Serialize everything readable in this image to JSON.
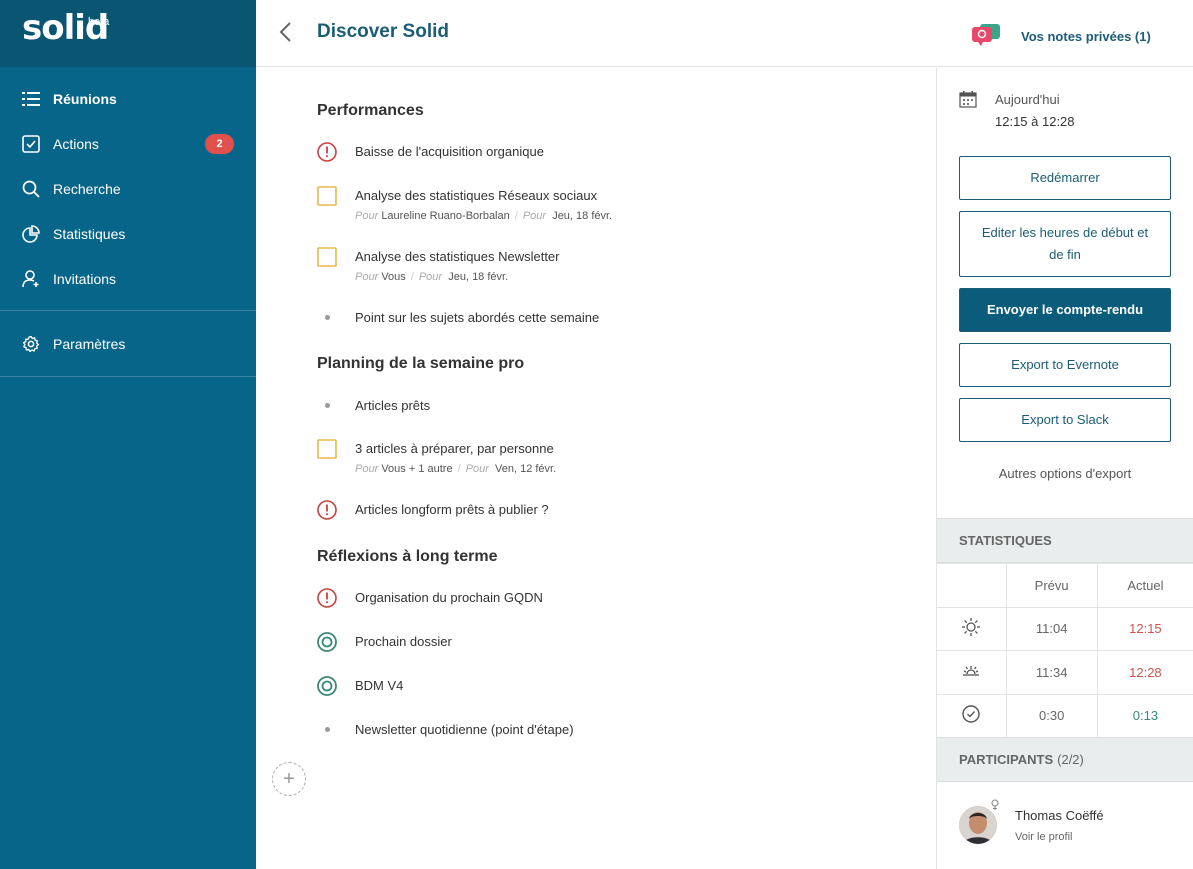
{
  "brand": {
    "logo": "solid",
    "badge": "beta"
  },
  "sidebar": {
    "items": [
      {
        "label": "Réunions",
        "icon": "list-icon"
      },
      {
        "label": "Actions",
        "icon": "checkbox-icon",
        "badge": "2"
      },
      {
        "label": "Recherche",
        "icon": "search-icon"
      },
      {
        "label": "Statistiques",
        "icon": "pie-chart-icon"
      },
      {
        "label": "Invitations",
        "icon": "user-add-icon"
      }
    ],
    "settings": {
      "label": "Paramètres",
      "icon": "gear-icon"
    }
  },
  "header": {
    "title": "Discover Solid",
    "notes_label": "Vos notes privées (1)"
  },
  "sections": [
    {
      "title": "Performances",
      "items": [
        {
          "type": "alert",
          "text": "Baisse de l'acquisition organique"
        },
        {
          "type": "action",
          "text": "Analyse des statistiques Réseaux sociaux",
          "pour_label": "Pour",
          "owner": "Laureline Ruano-Borbalan",
          "due": "Jeu, 18 févr."
        },
        {
          "type": "action",
          "text": "Analyse des statistiques Newsletter",
          "pour_label": "Pour",
          "owner": "Vous",
          "due": "Jeu, 18 févr."
        },
        {
          "type": "bullet",
          "text": "Point sur les sujets abordés cette semaine"
        }
      ]
    },
    {
      "title": "Planning de la semaine pro",
      "items": [
        {
          "type": "bullet",
          "text": "Articles prêts"
        },
        {
          "type": "action",
          "text": "3 articles à préparer, par personne",
          "pour_label": "Pour",
          "owner": "Vous + 1 autre",
          "due": "Ven, 12 févr."
        },
        {
          "type": "alert",
          "text": "Articles longform prêts à publier ?"
        }
      ]
    },
    {
      "title": "Réflexions à long terme",
      "items": [
        {
          "type": "alert",
          "text": "Organisation du prochain GQDN"
        },
        {
          "type": "target",
          "text": "Prochain dossier"
        },
        {
          "type": "target",
          "text": "BDM V4"
        },
        {
          "type": "bullet",
          "text": "Newsletter quotidienne (point d'étape)"
        }
      ]
    }
  ],
  "right": {
    "date_label": "Aujourd'hui",
    "time_range": "12:15 à 12:28",
    "buttons": {
      "restart": "Redémarrer",
      "edit_times": "Editer les heures de début et de fin",
      "send_report": "Envoyer le compte-rendu",
      "evernote": "Export to Evernote",
      "slack": "Export to Slack"
    },
    "other_export": "Autres options d'export",
    "stats": {
      "heading": "STATISTIQUES",
      "col_planned": "Prévu",
      "col_actual": "Actuel",
      "rows": [
        {
          "icon": "sunrise-icon",
          "planned": "11:04",
          "actual": "12:15"
        },
        {
          "icon": "sunset-icon",
          "planned": "11:34",
          "actual": "12:28"
        },
        {
          "icon": "clock-check-icon",
          "planned": "0:30",
          "actual": "0:13"
        }
      ]
    },
    "participants": {
      "heading": "PARTICIPANTS",
      "count": "(2/2)",
      "list": [
        {
          "name": "Thomas Coëffé",
          "link": "Voir le profil"
        }
      ]
    }
  },
  "colors": {
    "sidebar": "#08658a",
    "brand_bar": "#0a5572",
    "accent": "#1b5c76",
    "alert": "#c8423f",
    "action": "#e6b84b",
    "target": "#3a8a76",
    "late": "#d0544c"
  }
}
